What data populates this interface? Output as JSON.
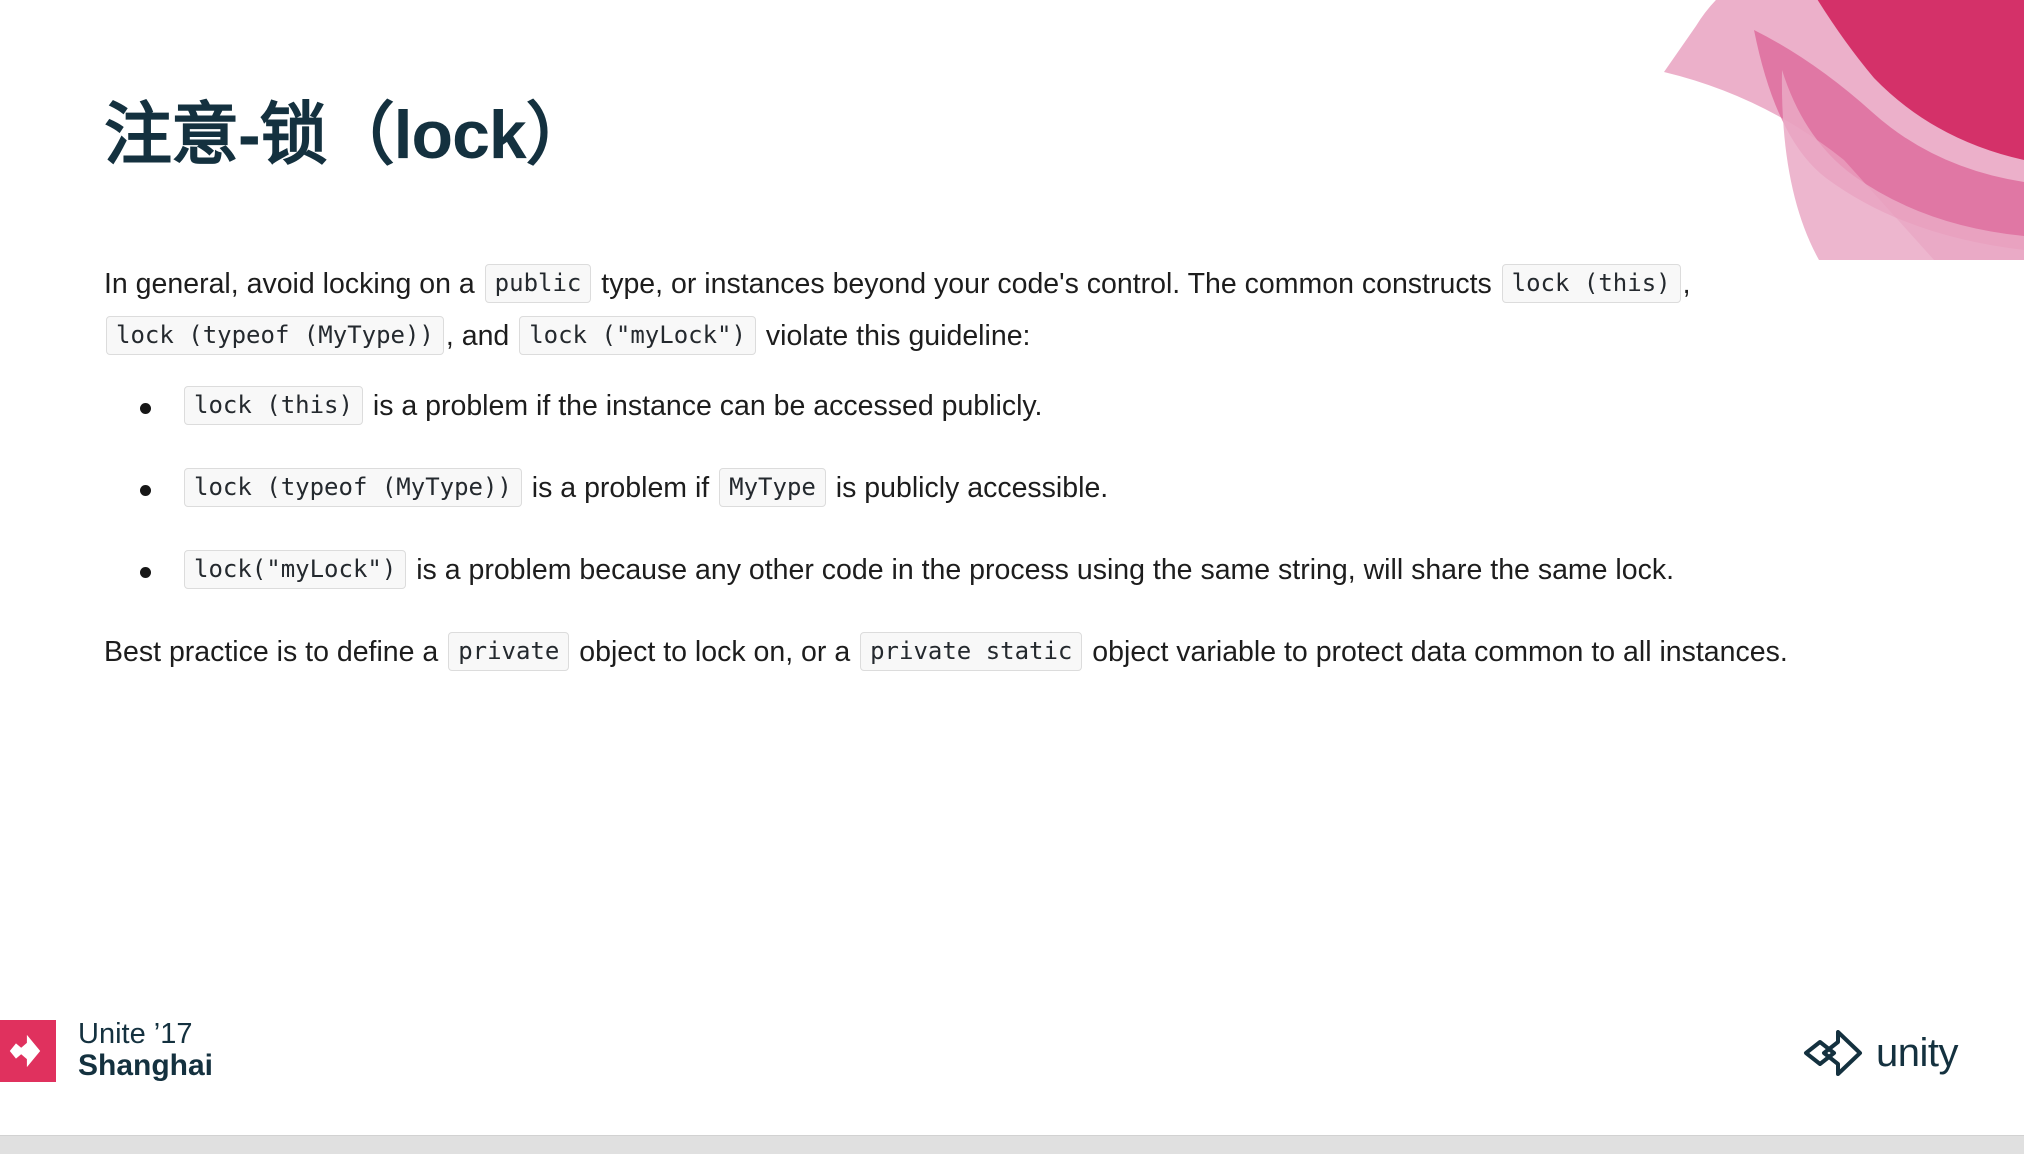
{
  "slide": {
    "title": "注意-锁（lock）",
    "intro": {
      "seg1": "In general, avoid locking on a ",
      "code1": "public",
      "seg2": " type, or instances beyond your code's control. The common constructs ",
      "code2": "lock (this)",
      "seg3": ", ",
      "code3": "lock (typeof (MyType))",
      "seg4": ", and ",
      "code4": "lock (\"myLock\")",
      "seg5": " violate this guideline:"
    },
    "bullets": [
      {
        "code1": "lock (this)",
        "text1": " is a problem if the instance can be accessed publicly.",
        "code2": "",
        "text2": ""
      },
      {
        "code1": "lock (typeof (MyType))",
        "text1": " is a problem if ",
        "code2": "MyType",
        "text2": " is publicly accessible."
      },
      {
        "code1": "lock(\"myLock\")",
        "text1": " is a problem because any other code in the process using the same string, will share the same lock.",
        "code2": "",
        "text2": ""
      }
    ],
    "outro": {
      "seg1": "Best practice is to define a ",
      "code1": "private",
      "seg2": " object to lock on, or a ",
      "code2": "private static",
      "seg3": " object variable to protect data common to all instances."
    }
  },
  "footer": {
    "unite_line1": "Unite ’17",
    "unite_line2": "Shanghai",
    "unity_wordmark": "unity",
    "unite_icon": "unity-cube-icon",
    "unity_icon": "unity-cube-icon"
  },
  "decor": {
    "shape_name": "pink-ribbon-decoration",
    "color_dark": "#d32a63",
    "color_mid": "#e27aa8",
    "color_light": "#eaa9c6",
    "title_color": "#14313f",
    "accent_color": "#e0315e"
  }
}
